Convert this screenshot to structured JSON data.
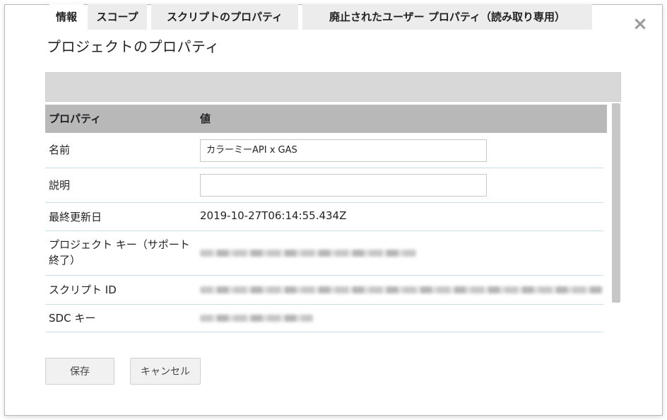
{
  "dialog": {
    "title": "プロジェクトのプロパティ",
    "close_icon": "close-icon"
  },
  "tabs": [
    {
      "label": "情報",
      "active": true
    },
    {
      "label": "スコープ",
      "active": false
    },
    {
      "label": "スクリプトのプロパティ",
      "active": false
    },
    {
      "label": "廃止されたユーザー プロパティ（読み取り専用）",
      "active": false
    }
  ],
  "table": {
    "headers": [
      "プロパティ",
      "値"
    ],
    "rows": [
      {
        "label": "名前",
        "value": "カラーミーAPI x GAS",
        "kind": "input"
      },
      {
        "label": "説明",
        "value": "",
        "kind": "input"
      },
      {
        "label": "最終更新日",
        "value": "2019-10-27T06:14:55.434Z",
        "kind": "text"
      },
      {
        "label": "プロジェクト キー（サポート終了）",
        "value": "",
        "kind": "blurred"
      },
      {
        "label": "スクリプト ID",
        "value": "",
        "kind": "blurred"
      },
      {
        "label": "SDC キー",
        "value": "",
        "kind": "blurred"
      }
    ]
  },
  "buttons": {
    "save": "保存",
    "cancel": "キャンセル"
  }
}
